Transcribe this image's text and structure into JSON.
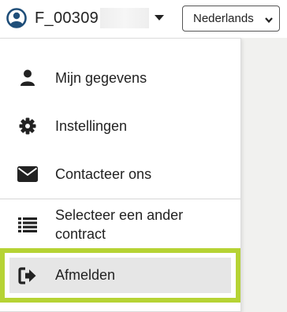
{
  "header": {
    "user_id_prefix": "F_00309",
    "user_icon": "user-circle-icon",
    "caret_icon": "caret-down-icon"
  },
  "language_select": {
    "selected": "Nederlands",
    "caret_icon": "chevron-down-icon"
  },
  "menu": {
    "items": [
      {
        "label": "Mijn gegevens",
        "icon": "user-icon"
      },
      {
        "label": "Instellingen",
        "icon": "gear-icon"
      },
      {
        "label": "Contacteer ons",
        "icon": "envelope-icon"
      },
      {
        "label": "Selecteer een ander contract",
        "icon": "list-icon"
      },
      {
        "label": "Afmelden",
        "icon": "sign-out-icon",
        "highlighted": true
      }
    ]
  },
  "colors": {
    "highlight_border": "#b6d334",
    "highlight_fill": "#e6e6e6",
    "user_icon": "#1f4e79",
    "side_background": "#f1f1ef"
  }
}
